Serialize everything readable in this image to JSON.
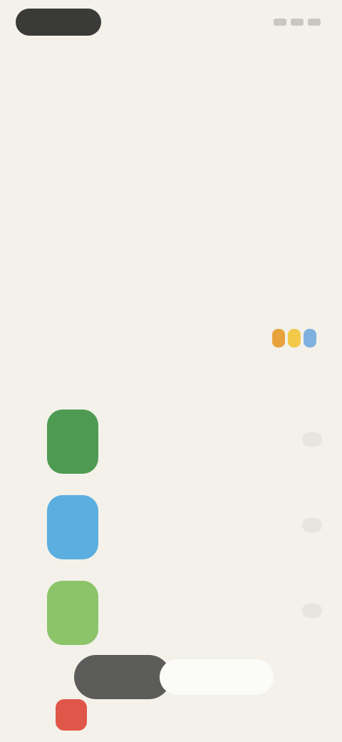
{
  "status": {
    "time": ""
  },
  "header": {
    "title": "",
    "description": ""
  },
  "sort": {
    "label": "",
    "brand": ""
  },
  "apps": [
    {
      "rank": "",
      "name": "",
      "meta": "",
      "color": "#4e9a52"
    },
    {
      "rank": "",
      "name": "",
      "meta": "",
      "color": "#5aaee0"
    },
    {
      "rank": "",
      "name": "",
      "meta": "",
      "color": "#8cc46a"
    }
  ],
  "toast": {
    "action": "",
    "message": ""
  },
  "colors": {
    "background": "#f3f1ea",
    "brand": [
      "#e8a23c",
      "#f3c94a",
      "#7fb0e0"
    ]
  }
}
